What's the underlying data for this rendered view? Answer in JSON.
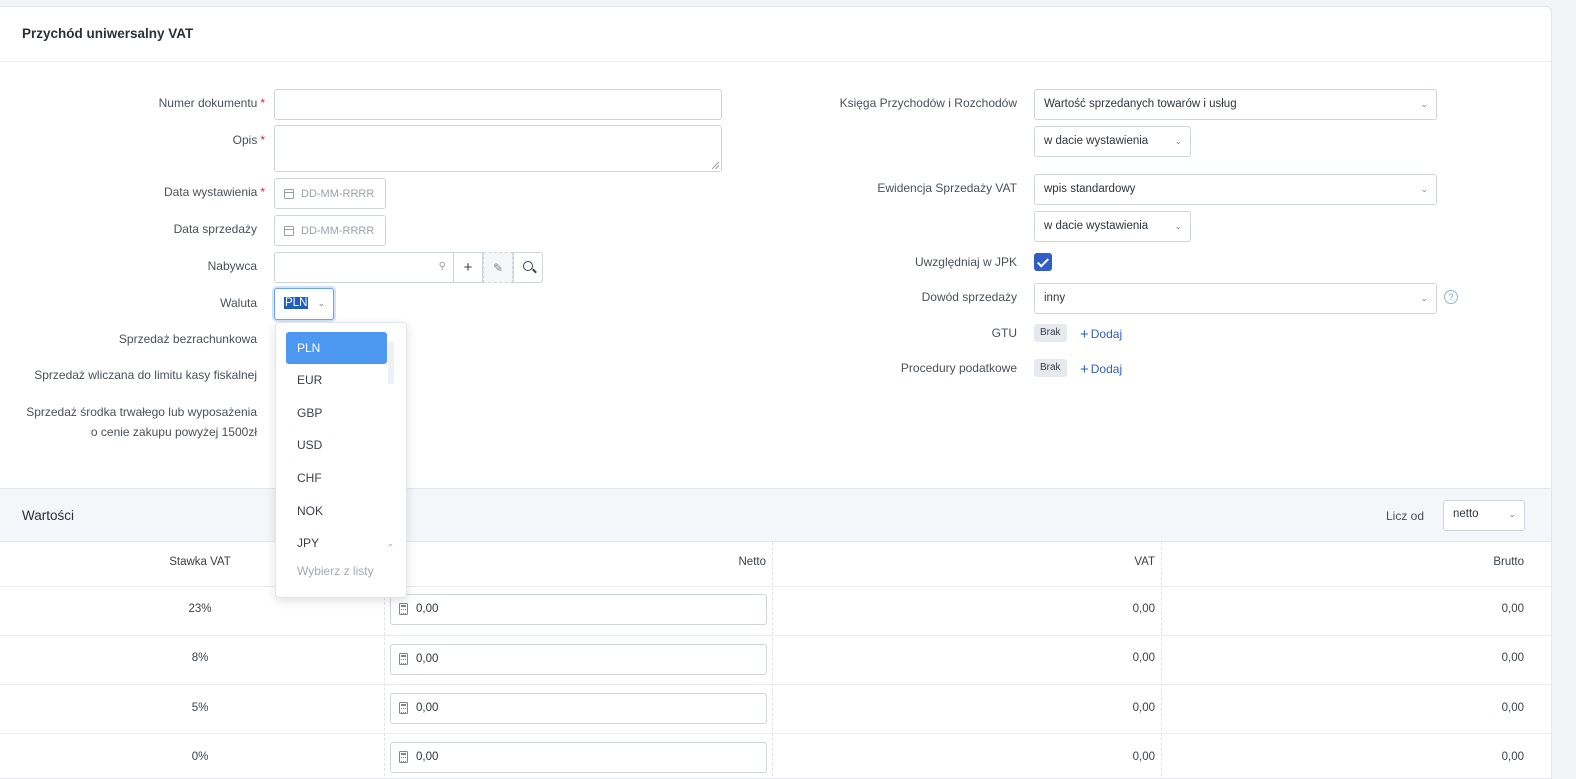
{
  "form": {
    "title": "Przychód uniwersalny VAT",
    "required_mark": "*",
    "left": {
      "document_number_label": "Numer dokumentu",
      "description_label": "Opis",
      "issue_date_label": "Data wystawienia",
      "issue_date_placeholder": "DD-MM-RRRR",
      "sale_date_label": "Data sprzedaży",
      "sale_date_placeholder": "DD-MM-RRRR",
      "buyer_label": "Nabywca",
      "currency_label": "Waluta",
      "currency_value": "PLN",
      "cashless_sale_label": "Sprzedaż bezrachunkowa",
      "fiscal_limit_label": "Sprzedaż wliczana do limitu kasy fiskalnej",
      "fixed_asset_label": "Sprzedaż środka trwałego lub wyposażenia o cenie zakupu powyżej 1500zł"
    },
    "right": {
      "kpir_label": "Księga Przychodów i Rozchodów",
      "kpir_value": "Wartość sprzedanych towarów i usług",
      "kpir_date_value": "w dacie wystawienia",
      "vat_register_label": "Ewidencja Sprzedaży VAT",
      "vat_register_value": "wpis standardowy",
      "vat_register_date_value": "w dacie wystawienia",
      "jpk_label": "Uwzględniaj w JPK",
      "jpk_checked": true,
      "sale_proof_label": "Dowód sprzedaży",
      "sale_proof_value": "inny",
      "help_glyph": "?",
      "gtu_label": "GTU",
      "gtu_badge": "Brak",
      "gtu_add": "Dodaj",
      "tax_proc_label": "Procedury podatkowe",
      "tax_proc_badge": "Brak",
      "tax_proc_add": "Dodaj"
    }
  },
  "currency_dropdown": {
    "options": [
      "PLN",
      "EUR",
      "GBP",
      "USD",
      "CHF",
      "NOK",
      "JPY"
    ],
    "selected": "PLN",
    "footer": "Wybierz z listy"
  },
  "values": {
    "title": "Wartości",
    "calc_from_label": "Licz od",
    "calc_from_value": "netto",
    "columns": {
      "rate": "Stawka VAT",
      "net": "Netto",
      "vat": "VAT",
      "gross": "Brutto"
    },
    "rows": [
      {
        "rate": "23%",
        "net": "0,00",
        "vat": "0,00",
        "gross": "0,00"
      },
      {
        "rate": "8%",
        "net": "0,00",
        "vat": "0,00",
        "gross": "0,00"
      },
      {
        "rate": "5%",
        "net": "0,00",
        "vat": "0,00",
        "gross": "0,00"
      },
      {
        "rate": "0%",
        "net": "0,00",
        "vat": "0,00",
        "gross": "0,00"
      }
    ]
  },
  "icons": {
    "calendar": "calendar-icon",
    "search": "search-icon",
    "plus": "plus-icon",
    "edit": "edit-icon",
    "calculator": "calculator-icon",
    "chevron": "chevron-down-icon"
  }
}
